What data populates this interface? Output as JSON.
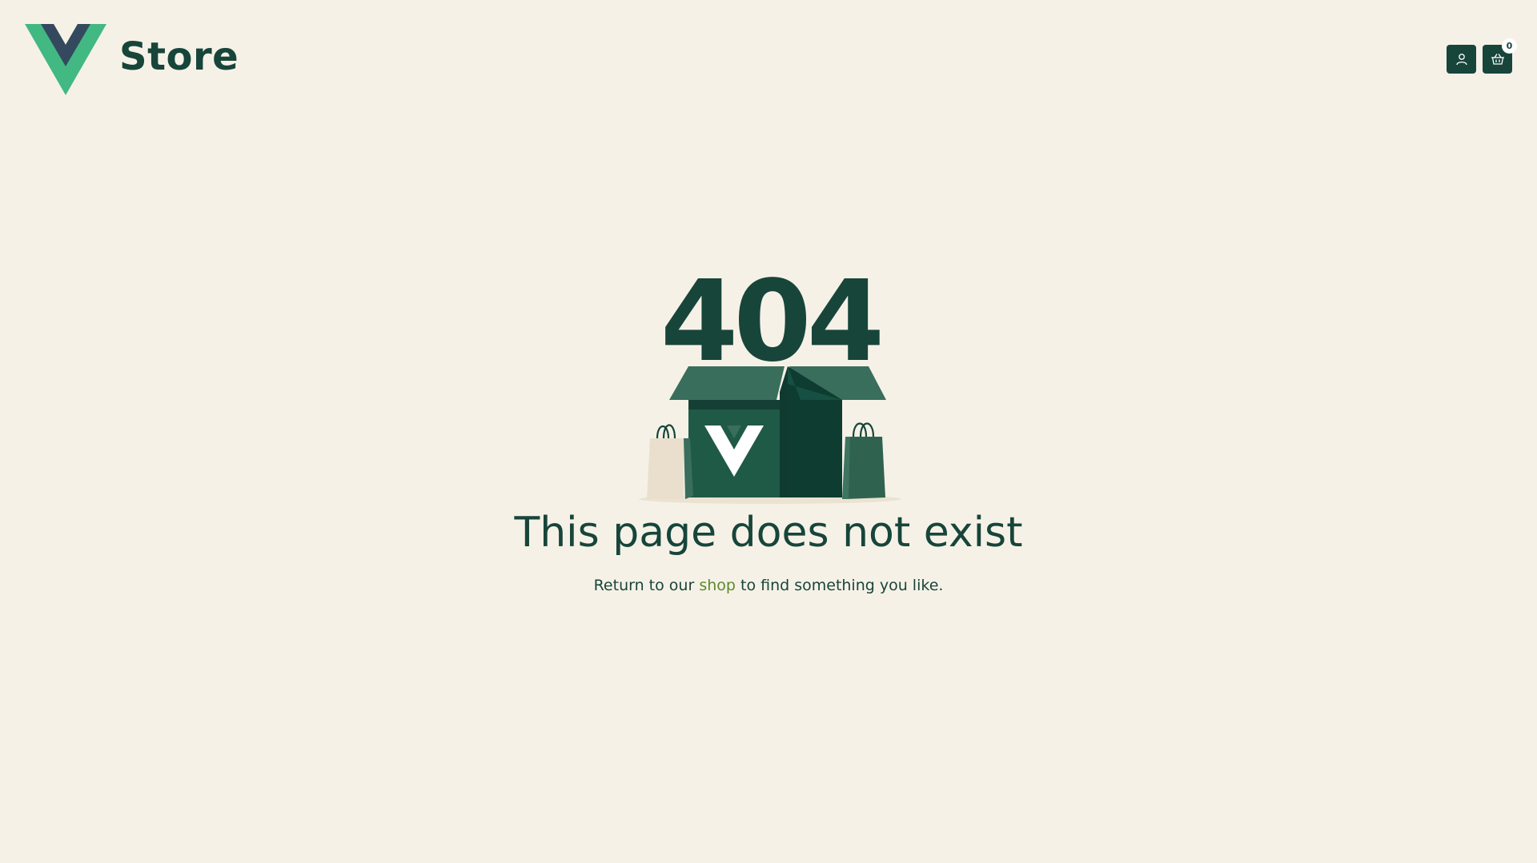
{
  "header": {
    "brand_name": "Store",
    "cart_count": "0",
    "icons": {
      "logo": "vue-v-logo-icon",
      "account": "user-icon",
      "cart": "basket-icon"
    }
  },
  "error": {
    "code": "404",
    "heading": "This page does not exist",
    "subtext_before": "Return to our",
    "link_text": "shop",
    "subtext_after": "to find something you like."
  },
  "colors": {
    "background": "#F6F1E7",
    "primary_dark": "#17453a",
    "logo_green": "#42b883",
    "logo_dark": "#35495e",
    "link_green": "#5d8a2c"
  }
}
